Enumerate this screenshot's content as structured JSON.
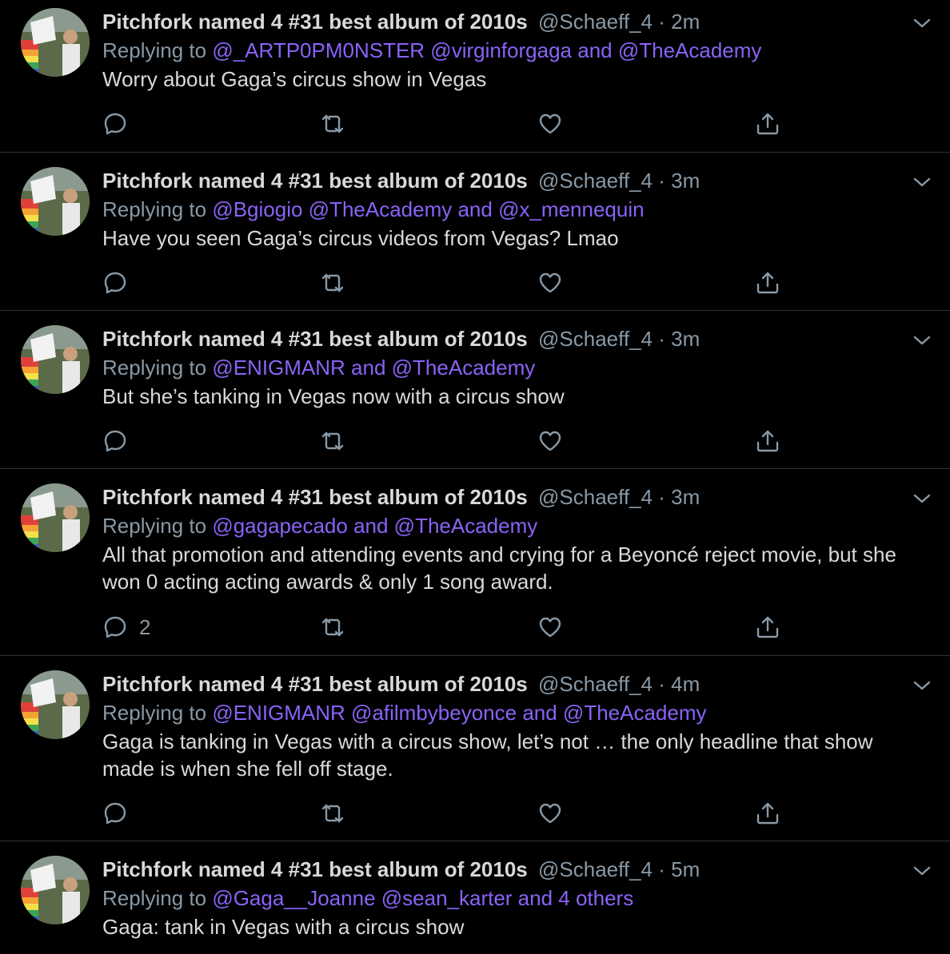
{
  "colors": {
    "background": "#000000",
    "text": "#d9d9d9",
    "muted": "#8899a6",
    "mention": "#8a63f7",
    "divider": "#2f3336"
  },
  "icons": {
    "reply": "reply-icon",
    "retweet": "retweet-icon",
    "like": "like-icon",
    "share": "share-icon",
    "more": "chevron-down-icon"
  },
  "tweets": [
    {
      "display_name": "Pitchfork named 4 #31 best album of 2010s",
      "handle_time": "@Schaeff_4 · 2m",
      "replying_prefix": "Replying to",
      "replying_mentions": "@_ARTP0PM0NSTER @virginforgaga and @TheAcademy",
      "text": "Worry about Gaga’s circus show in Vegas",
      "reply_count": ""
    },
    {
      "display_name": "Pitchfork named 4 #31 best album of 2010s",
      "handle_time": "@Schaeff_4 · 3m",
      "replying_prefix": "Replying to",
      "replying_mentions": "@Bgiogio @TheAcademy and @x_mennequin",
      "text": "Have you seen Gaga’s circus videos from Vegas? Lmao",
      "reply_count": ""
    },
    {
      "display_name": "Pitchfork named 4 #31 best album of 2010s",
      "handle_time": "@Schaeff_4 · 3m",
      "replying_prefix": "Replying to",
      "replying_mentions": "@ENIGMANR and @TheAcademy",
      "text": "But she’s tanking in Vegas now with a circus show",
      "reply_count": ""
    },
    {
      "display_name": "Pitchfork named 4 #31 best album of 2010s",
      "handle_time": "@Schaeff_4 · 3m",
      "replying_prefix": "Replying to",
      "replying_mentions": "@gagapecado and @TheAcademy",
      "text": "All that promotion and attending events and crying for a Beyoncé reject movie, but she won 0 acting acting awards & only 1 song award.",
      "reply_count": "2"
    },
    {
      "display_name": "Pitchfork named 4 #31 best album of 2010s",
      "handle_time": "@Schaeff_4 · 4m",
      "replying_prefix": "Replying to",
      "replying_mentions": "@ENIGMANR @afilmbybeyonce and @TheAcademy",
      "text": "Gaga is tanking in Vegas with a circus show, let’s not … the only headline that show made is when she fell off stage.",
      "reply_count": ""
    },
    {
      "display_name": "Pitchfork named 4 #31 best album of 2010s",
      "handle_time": "@Schaeff_4 · 5m",
      "replying_prefix": "Replying to",
      "replying_mentions": "@Gaga__Joanne @sean_karter and 4 others",
      "text": "Gaga: tank in Vegas with a circus show",
      "reply_count": ""
    }
  ]
}
